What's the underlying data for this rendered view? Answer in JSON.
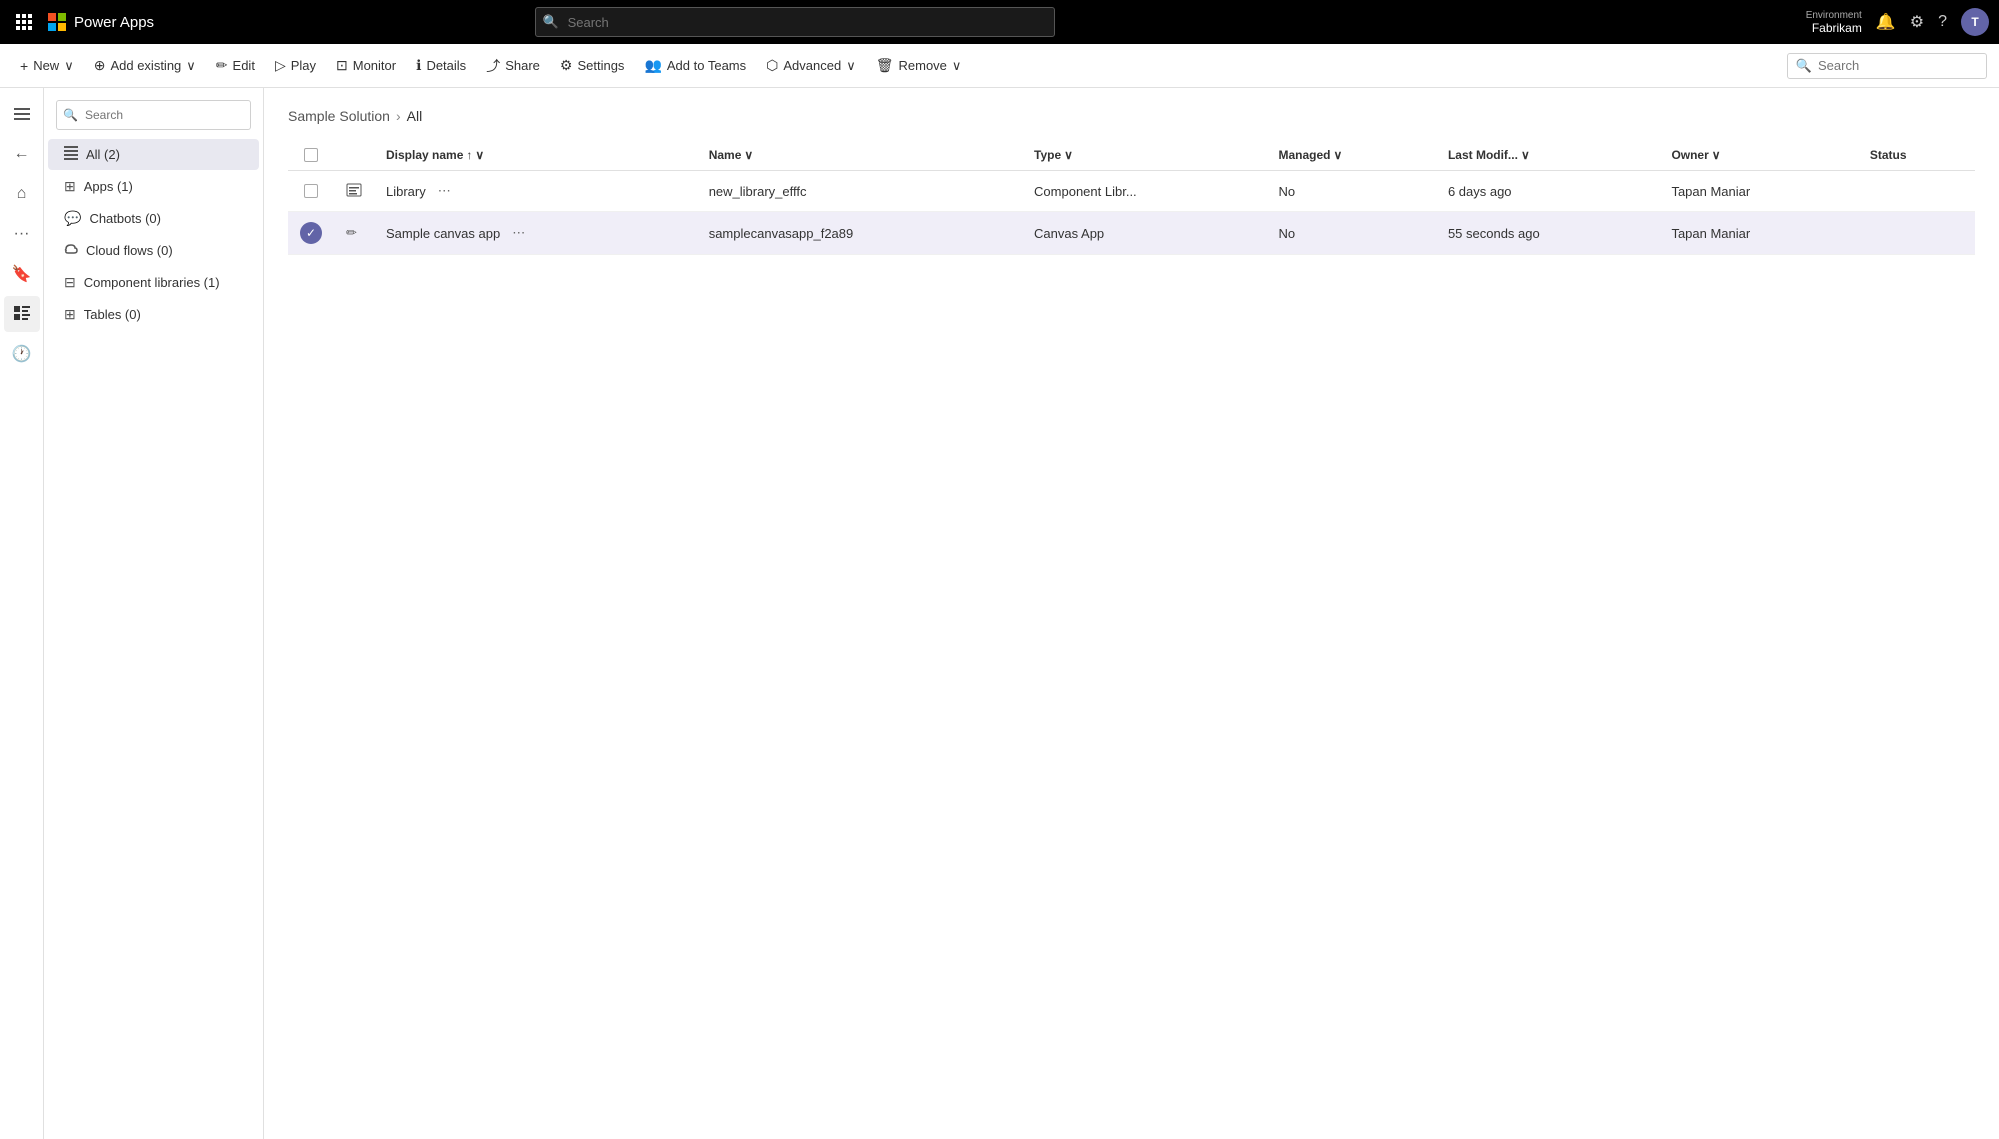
{
  "topbar": {
    "app_name": "Power Apps",
    "search_placeholder": "Search",
    "environment_label": "Environment",
    "environment_name": "Fabrikam",
    "avatar_initials": "T"
  },
  "commandbar": {
    "new_label": "New",
    "add_existing_label": "Add existing",
    "edit_label": "Edit",
    "play_label": "Play",
    "monitor_label": "Monitor",
    "details_label": "Details",
    "share_label": "Share",
    "settings_label": "Settings",
    "add_to_teams_label": "Add to Teams",
    "advanced_label": "Advanced",
    "remove_label": "Remove",
    "search_placeholder": "Search"
  },
  "sidebar": {
    "search_placeholder": "Search",
    "items": [
      {
        "label": "All (2)",
        "icon": "≡",
        "count": 2,
        "active": true
      },
      {
        "label": "Apps (1)",
        "icon": "⊞",
        "count": 1,
        "active": false
      },
      {
        "label": "Chatbots (0)",
        "icon": "💬",
        "count": 0,
        "active": false
      },
      {
        "label": "Cloud flows (0)",
        "icon": "~",
        "count": 0,
        "active": false
      },
      {
        "label": "Component libraries (1)",
        "icon": "⊟",
        "count": 1,
        "active": false
      },
      {
        "label": "Tables (0)",
        "icon": "⊞",
        "count": 0,
        "active": false
      }
    ]
  },
  "breadcrumb": {
    "parent": "Sample Solution",
    "current": "All"
  },
  "table": {
    "columns": [
      {
        "key": "display_name",
        "label": "Display name",
        "sortable": true,
        "sorted": "asc"
      },
      {
        "key": "name",
        "label": "Name",
        "sortable": true
      },
      {
        "key": "type",
        "label": "Type",
        "sortable": true
      },
      {
        "key": "managed",
        "label": "Managed",
        "sortable": true
      },
      {
        "key": "last_modified",
        "label": "Last Modif...",
        "sortable": true
      },
      {
        "key": "owner",
        "label": "Owner",
        "sortable": true
      },
      {
        "key": "status",
        "label": "Status",
        "sortable": false
      }
    ],
    "rows": [
      {
        "id": 1,
        "display_name": "Library",
        "name": "new_library_efffc",
        "type": "Component Libr...",
        "managed": "No",
        "last_modified": "6 days ago",
        "owner": "Tapan Maniar",
        "status": "",
        "selected": false,
        "icon_type": "library"
      },
      {
        "id": 2,
        "display_name": "Sample canvas app",
        "name": "samplecanvasapp_f2a89",
        "type": "Canvas App",
        "managed": "No",
        "last_modified": "55 seconds ago",
        "owner": "Tapan Maniar",
        "status": "",
        "selected": true,
        "icon_type": "canvas"
      }
    ]
  },
  "icons": {
    "waffle": "⋮⋮",
    "back": "←",
    "home": "⌂",
    "more": "···",
    "bookmark": "🔖",
    "list": "≡",
    "history": "🕐",
    "search": "🔍",
    "notification": "🔔",
    "settings_gear": "⚙",
    "help": "?",
    "plus": "+",
    "add_existing": "⊕",
    "edit": "✏",
    "play": "▷",
    "monitor": "⊡",
    "details": "ℹ",
    "share": "⤴",
    "settings": "⚙",
    "add_teams": "👥",
    "advanced": "⬡",
    "remove": "🗑",
    "chevron_down": "∨",
    "sort_asc": "↑",
    "sort_icon": "∨"
  }
}
